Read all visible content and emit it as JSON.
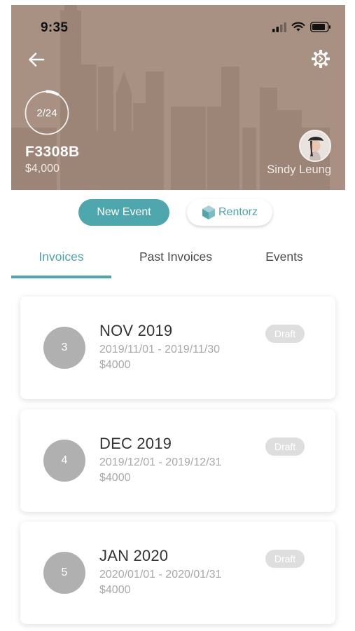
{
  "status_bar": {
    "time": "9:35"
  },
  "header": {
    "back_icon": "arrow-left-icon",
    "settings_icon": "gear-icon",
    "progress_text": "2/24",
    "progress_fraction": 0.083,
    "unit_code": "F3308B",
    "unit_price": "$4,000",
    "tenant_name": "Sindy Leung",
    "background_color": "#a89183"
  },
  "actions": {
    "new_event_label": "New Event",
    "rentorz_label": "Rentorz"
  },
  "tabs": [
    {
      "label": "Invoices",
      "active": true
    },
    {
      "label": "Past Invoices",
      "active": false
    },
    {
      "label": "Events",
      "active": false
    }
  ],
  "accent_color": "#4ea7ad",
  "invoices": [
    {
      "number": "3",
      "title": "NOV 2019",
      "range": "2019/11/01 - 2019/11/30",
      "amount": "$4000",
      "status": "Draft"
    },
    {
      "number": "4",
      "title": "DEC 2019",
      "range": "2019/12/01 - 2019/12/31",
      "amount": "$4000",
      "status": "Draft"
    },
    {
      "number": "5",
      "title": "JAN 2020",
      "range": "2020/01/01 - 2020/01/31",
      "amount": "$4000",
      "status": "Draft"
    }
  ]
}
